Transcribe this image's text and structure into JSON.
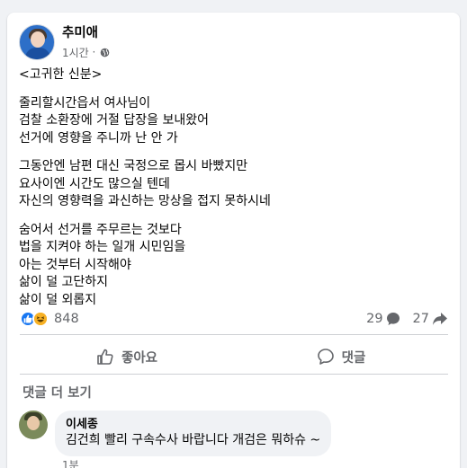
{
  "post": {
    "author": "추미애",
    "time": "1시간",
    "paragraphs": [
      [
        "<고귀한 신분>"
      ],
      [
        "줄리할시간읍서 여사님이",
        "검찰 소환장에 거절 답장을 보내왔어",
        "선거에 영향을 주니까 난 안 가"
      ],
      [
        "그동안엔 남편 대신 국정으로 몹시 바빴지만",
        "요사이엔 시간도 많으실 텐데",
        "자신의 영향력을 과신하는 망상을 접지 못하시네"
      ],
      [
        "숨어서 선거를 주무르는 것보다",
        "법을 지켜야 하는 일개 시민임을",
        "아는 것부터 시작해야",
        "삶이 덜 고단하지",
        "삶이 덜 외롭지"
      ]
    ]
  },
  "stats": {
    "reactions": "848",
    "comments": "29",
    "shares": "27"
  },
  "actions": {
    "like": "좋아요",
    "comment": "댓글"
  },
  "more_comments": "댓글 더 보기",
  "comment": {
    "name": "이세종",
    "text": "김건희 빨리 구속수사 바랍니다 개검은 뭐하슈 ~",
    "time": "1분"
  },
  "colors": {
    "brand": "#1877f2",
    "secondary_text": "#65676b",
    "background": "#f0f2f5"
  }
}
